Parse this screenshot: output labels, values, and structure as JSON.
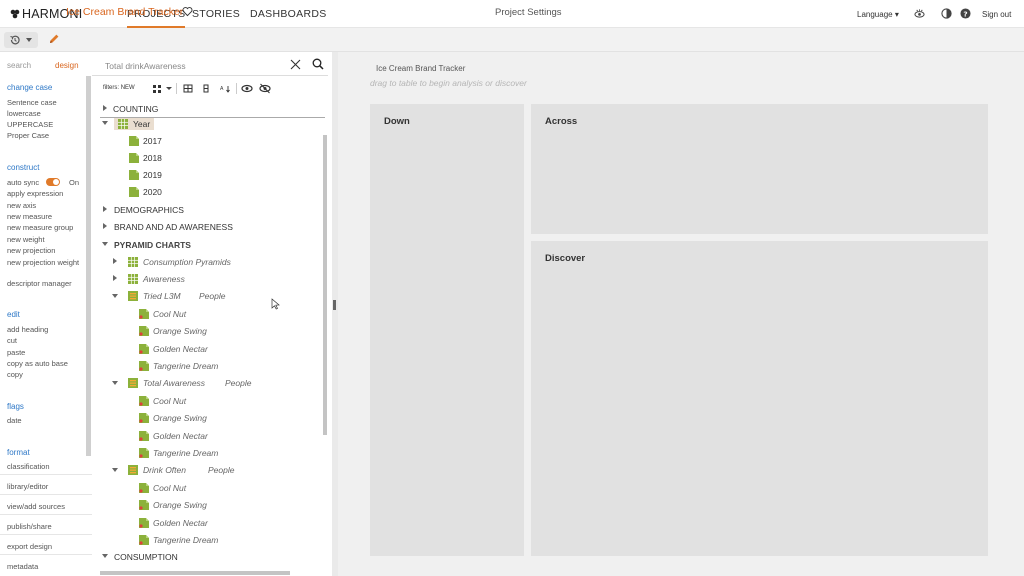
{
  "nav": {
    "brand": "HARMONI",
    "tabs": [
      "PROJECTS",
      "STORIES",
      "DASHBOARDS"
    ],
    "active_tab": "PROJECTS",
    "language": "Language ▾",
    "signout": "Sign out",
    "accent": "#e07a2a"
  },
  "project": {
    "title": "Ice Cream Brand Tracker",
    "panel_title": "Project Settings"
  },
  "sidebar": {
    "tabs": [
      "search",
      "design"
    ],
    "search_text": "Total drinkAwareness",
    "sections": [
      {
        "heading": "change case",
        "items": [
          "Sentence case",
          "lowercase",
          "UPPERCASE",
          "Proper Case"
        ]
      },
      {
        "heading": "construct",
        "items": [
          "auto sync",
          "apply expression",
          "new axis",
          "new measure",
          "new measure group",
          "new weight",
          "new projection",
          "new projection weight",
          "descriptor manager"
        ]
      },
      {
        "heading": "edit",
        "items": [
          "add heading",
          "cut",
          "paste",
          "copy as auto base",
          "copy"
        ]
      },
      {
        "heading": "flags",
        "items": [
          "date"
        ]
      },
      {
        "heading": "format",
        "items": [
          "classification",
          "library/editor",
          "view/add sources",
          "publish/share",
          "export design",
          "metadata"
        ]
      }
    ],
    "auto_sync_state": "On",
    "filters_label": "filters:",
    "filters_value": "NEW"
  },
  "tree": {
    "rows": [
      {
        "label": "COUNTING"
      },
      {
        "label": "Year"
      },
      {
        "label": "2017"
      },
      {
        "label": "2018"
      },
      {
        "label": "2019"
      },
      {
        "label": "2020"
      },
      {
        "label": "DEMOGRAPHICS"
      },
      {
        "label": "BRAND AND AD AWARENESS"
      },
      {
        "label": "PYRAMID CHARTS"
      },
      {
        "label": "Consumption Pyramids"
      },
      {
        "label": "Awareness"
      },
      {
        "label": "Tried L3M",
        "tag": "People"
      },
      {
        "label": "Cool Nut"
      },
      {
        "label": "Orange Swing"
      },
      {
        "label": "Golden Nectar"
      },
      {
        "label": "Tangerine Dream"
      },
      {
        "label": "Total Awareness",
        "tag": "People"
      },
      {
        "label": "Cool Nut"
      },
      {
        "label": "Orange Swing"
      },
      {
        "label": "Golden Nectar"
      },
      {
        "label": "Tangerine Dream"
      },
      {
        "label": "Drink Often",
        "tag": "People"
      },
      {
        "label": "Cool Nut"
      },
      {
        "label": "Orange Swing"
      },
      {
        "label": "Golden Nectar"
      },
      {
        "label": "Tangerine Dream"
      },
      {
        "label": "CONSUMPTION"
      }
    ]
  },
  "canvas": {
    "table_title": "Ice Cream Brand Tracker",
    "drag_hint": "drag to table to begin analysis or discover",
    "zones": [
      "Down",
      "Across",
      "Discover"
    ]
  }
}
